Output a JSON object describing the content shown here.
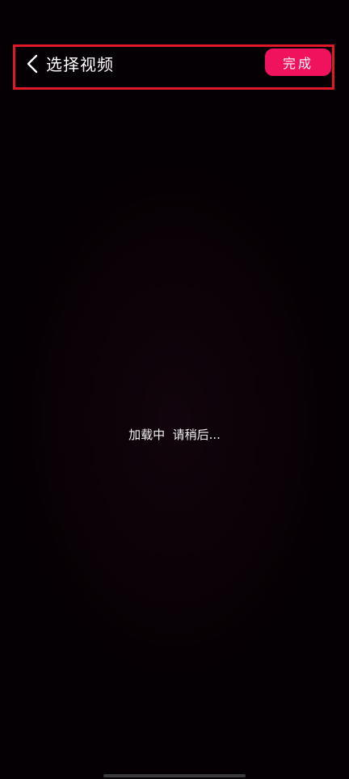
{
  "header": {
    "back_icon": "chevron-left-icon",
    "title": "选择视频",
    "done_label": "完成"
  },
  "main": {
    "loading_text": "加载中  请稍后..."
  },
  "colors": {
    "background": "#050003",
    "accent": "#f0125c",
    "highlight_border": "#e0192a"
  }
}
